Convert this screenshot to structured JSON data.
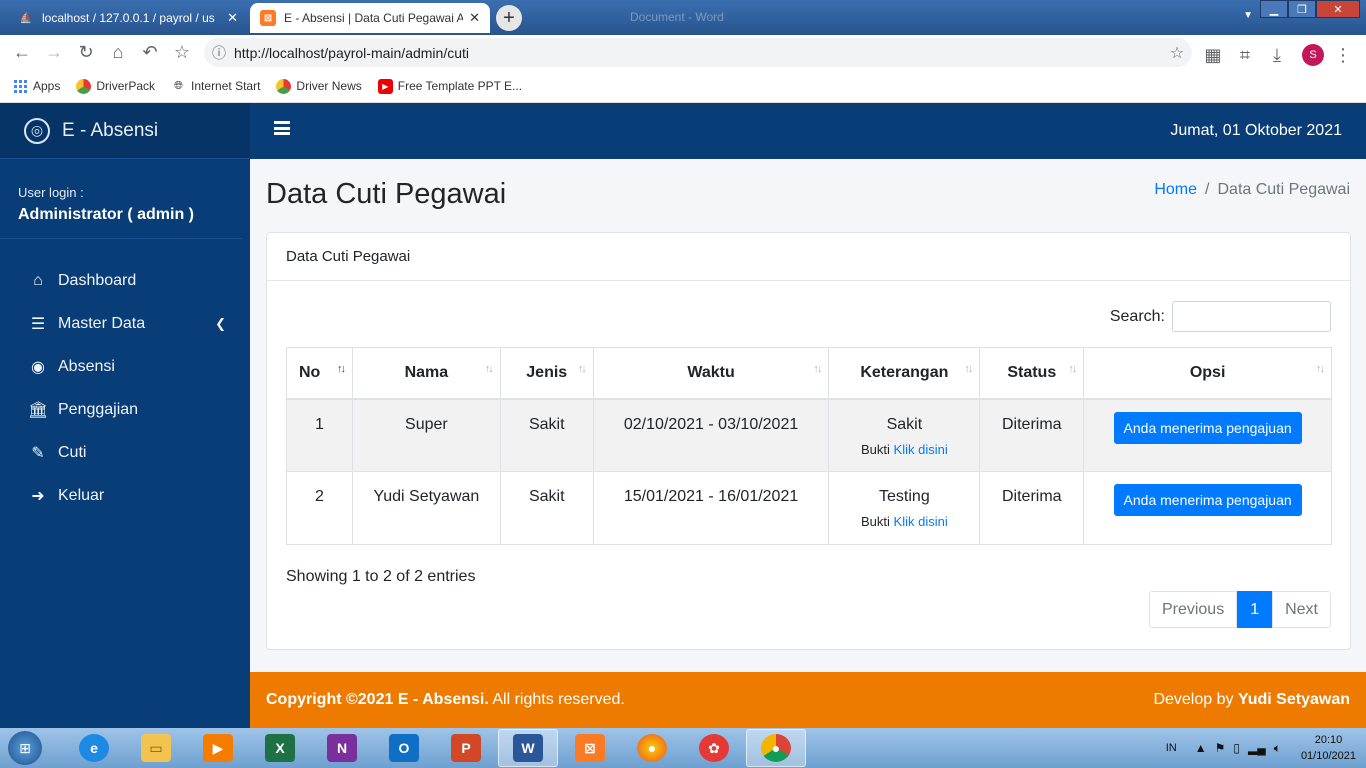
{
  "browser": {
    "tabs": [
      {
        "title": "localhost / 127.0.0.1 / payrol / us",
        "active": false
      },
      {
        "title": "E - Absensi | Data Cuti Pegawai A",
        "active": true
      }
    ],
    "window_title": "Document - Word",
    "url": "http://localhost/payrol-main/admin/cuti",
    "profile_initial": "S",
    "bookmarks": [
      {
        "label": "Apps"
      },
      {
        "label": "DriverPack"
      },
      {
        "label": "Internet Start"
      },
      {
        "label": "Driver News"
      },
      {
        "label": "Free Template PPT E..."
      }
    ]
  },
  "app": {
    "brand": "E - Absensi",
    "user_label": "User login :",
    "user_name": "Administrator ( admin )",
    "nav": [
      {
        "label": "Dashboard",
        "icon": "home-icon"
      },
      {
        "label": "Master Data",
        "icon": "list-icon"
      },
      {
        "label": "Absensi",
        "icon": "fingerprint-icon"
      },
      {
        "label": "Penggajian",
        "icon": "bank-icon"
      },
      {
        "label": "Cuti",
        "icon": "edit-icon"
      },
      {
        "label": "Keluar",
        "icon": "sign-out-icon"
      }
    ],
    "date": "Jumat, 01 Oktober 2021",
    "page_title": "Data Cuti Pegawai",
    "breadcrumb": {
      "home": "Home",
      "current": "Data Cuti Pegawai"
    },
    "card_title": "Data Cuti Pegawai",
    "search_label": "Search:",
    "search_value": "",
    "columns": [
      "No",
      "Nama",
      "Jenis",
      "Waktu",
      "Keterangan",
      "Status",
      "Opsi"
    ],
    "rows": [
      {
        "no": "1",
        "nama": "Super",
        "jenis": "Sakit",
        "waktu": "02/10/2021 - 03/10/2021",
        "keterangan": "Sakit",
        "bukti_label": "Bukti",
        "bukti_link": "Klik disini",
        "status": "Diterima",
        "opsi": "Anda menerima pengajuan"
      },
      {
        "no": "2",
        "nama": "Yudi Setyawan",
        "jenis": "Sakit",
        "waktu": "15/01/2021 - 16/01/2021",
        "keterangan": "Testing",
        "bukti_label": "Bukti",
        "bukti_link": "Klik disini",
        "status": "Diterima",
        "opsi": "Anda menerima pengajuan"
      }
    ],
    "info": "Showing 1 to 2 of 2 entries",
    "pagination": {
      "previous": "Previous",
      "page": "1",
      "next": "Next"
    },
    "footer": {
      "copyright_bold": "Copyright ©2021 E - Absensi.",
      "copyright_rest": " All rights reserved.",
      "develop_prefix": "Develop by ",
      "developer": "Yudi Setyawan"
    },
    "colors": {
      "sidebar": "#083d77",
      "primary": "#007bff",
      "footer": "#ee7a00"
    }
  },
  "taskbar": {
    "lang": "IN",
    "time": "20:10",
    "date": "01/10/2021"
  }
}
